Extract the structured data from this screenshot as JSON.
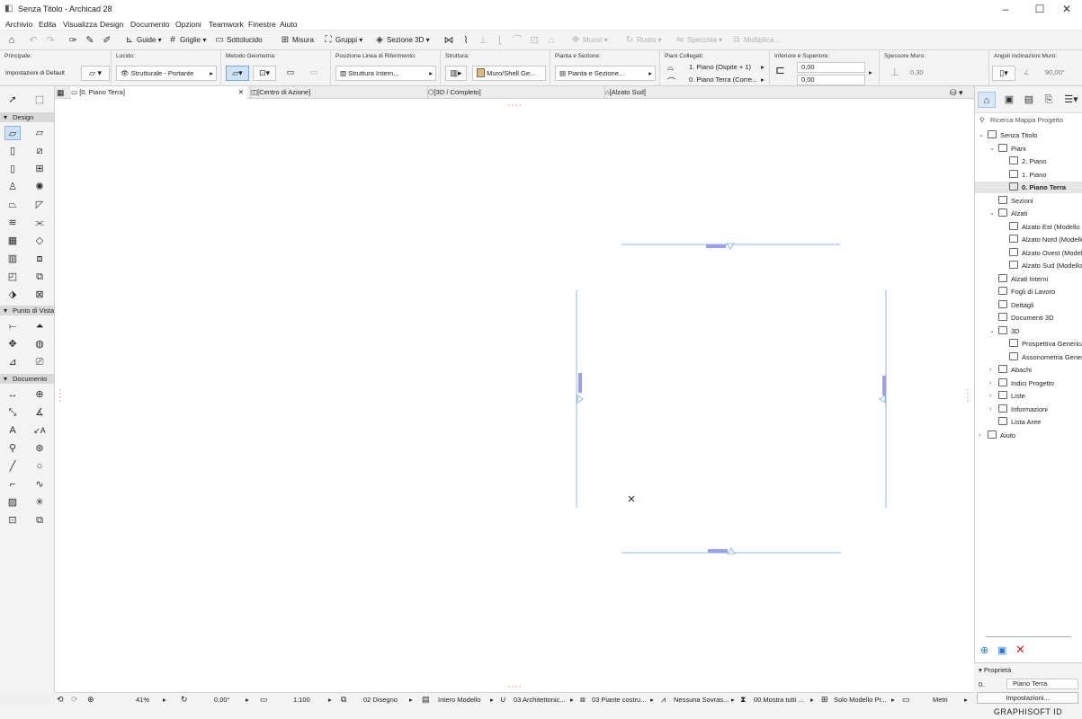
{
  "window": {
    "title": "Senza Titolo - Archicad 28"
  },
  "menu": [
    "Archivio",
    "Edita",
    "Visualizza",
    "Design",
    "Documento",
    "Opzioni",
    "Teamwork",
    "Finestre",
    "Aiuto"
  ],
  "toolbar": {
    "guide": "Guide",
    "griglie": "Griglie",
    "sottolucido": "Sottolucido",
    "misura": "Misura",
    "gruppi": "Gruppi",
    "sezione3d": "Sezione 3D",
    "muovi": "Muovi",
    "ruota": "Ruota",
    "specchia": "Specchia",
    "moltiplica": "Moltiplica..."
  },
  "infobox": {
    "principale_label": "Principale:",
    "principale_value": "Impostazioni di Default",
    "lucido_label": "Lucido:",
    "lucido_value": "Strutturale - Portante",
    "metodo_label": "Metodo Geometria:",
    "posizione_label": "Posizione Linea di Riferimento:",
    "posizione_value": "Struttura Intern...",
    "struttura_label": "Struttura:",
    "struttura_value": "Muro/Shell Ge...",
    "pianta_label": "Pianta e Sezione:",
    "pianta_value": "Pianta e Sezione...",
    "piani_label": "Piani Collegati:",
    "piano_top": "1. Piano (Ospite + 1)",
    "piano_bottom": "0. Piano Terra (Corre...",
    "inferiore_label": "Inferiore e Superiore:",
    "inferiore_top": "0,00",
    "inferiore_bottom": "0,00",
    "spessore_label": "Spessore Muro:",
    "spessore_value": "0,30",
    "angoli_label": "Angoli inclinazioni Muro:",
    "angoli_value": "90,00°"
  },
  "tabs": [
    "[0. Piano Terra]",
    "[Centro di Azione]",
    "[3D / Completo]",
    "[Alzato Sud]"
  ],
  "toolbox": {
    "sections": [
      "Design",
      "Punto di Vista",
      "Documento"
    ]
  },
  "navigator": {
    "search_placeholder": "Ricerca Mappa Progetto",
    "tree": [
      {
        "label": "Senza Titolo",
        "level": 0,
        "arrow": "v"
      },
      {
        "label": "Piani",
        "level": 1,
        "arrow": "v"
      },
      {
        "label": "2. Piano",
        "level": 2,
        "arrow": ""
      },
      {
        "label": "1. Piano",
        "level": 2,
        "arrow": ""
      },
      {
        "label": "0. Piano Terra",
        "level": 2,
        "arrow": "",
        "selected": true
      },
      {
        "label": "Sezioni",
        "level": 1,
        "arrow": ""
      },
      {
        "label": "Alzati",
        "level": 1,
        "arrow": "v"
      },
      {
        "label": "Alzato Est (Modello co",
        "level": 2,
        "arrow": ""
      },
      {
        "label": "Alzato Nord (Modello c",
        "level": 2,
        "arrow": ""
      },
      {
        "label": "Alzato Ovest (Modello",
        "level": 2,
        "arrow": ""
      },
      {
        "label": "Alzato Sud (Modello co",
        "level": 2,
        "arrow": ""
      },
      {
        "label": "Alzati Interni",
        "level": 1,
        "arrow": ""
      },
      {
        "label": "Fogli di Lavoro",
        "level": 1,
        "arrow": ""
      },
      {
        "label": "Dettagli",
        "level": 1,
        "arrow": ""
      },
      {
        "label": "Documenti 3D",
        "level": 1,
        "arrow": ""
      },
      {
        "label": "3D",
        "level": 1,
        "arrow": "v"
      },
      {
        "label": "Prospettiva Generica",
        "level": 2,
        "arrow": ""
      },
      {
        "label": "Assonometria Generica",
        "level": 2,
        "arrow": ""
      },
      {
        "label": "Abachi",
        "level": 1,
        "arrow": ">"
      },
      {
        "label": "Indici Progetto",
        "level": 1,
        "arrow": ">"
      },
      {
        "label": "Liste",
        "level": 1,
        "arrow": ">"
      },
      {
        "label": "Informazioni",
        "level": 1,
        "arrow": ">"
      },
      {
        "label": "Lista Aree",
        "level": 1,
        "arrow": ""
      },
      {
        "label": "Aiuto",
        "level": 0,
        "arrow": ">"
      }
    ],
    "proprieta_label": "Proprietà",
    "prop_id": "0.",
    "prop_name": "Piano Terra",
    "impostazioni": "Impostazioni..."
  },
  "statusbar": {
    "zoom": "41%",
    "angle": "0,00°",
    "scale": "1:100",
    "layer_combo": "02 Disegno",
    "model": "Intero Modello",
    "pen": "03 Architettonic...",
    "mvo": "03 Piante costru...",
    "override": "Nessuna Sovras...",
    "reno": "00 Mostra tutti ...",
    "struct": "Solo Modello Pr...",
    "units": "Metri"
  },
  "brand": "GRAPHISOFT ID"
}
